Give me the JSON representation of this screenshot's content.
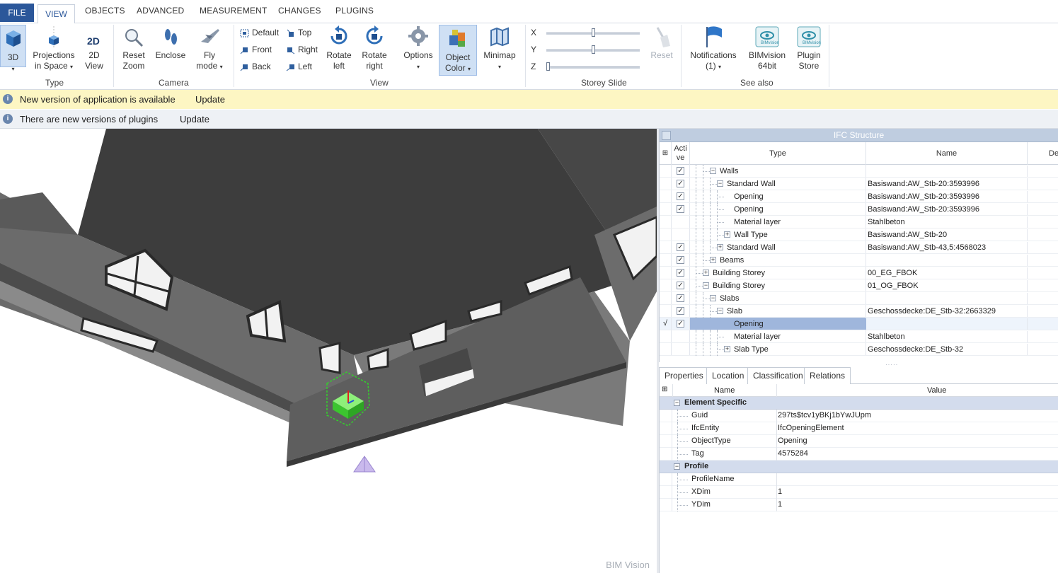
{
  "menu": {
    "file": "FILE",
    "tabs": [
      "VIEW",
      "OBJECTS",
      "ADVANCED",
      "MEASUREMENT",
      "CHANGES",
      "PLUGINS"
    ]
  },
  "ribbon": {
    "type_group": {
      "label": "Type",
      "btn_3d": "3D",
      "projections": [
        "Projections",
        "in Space"
      ],
      "view2d": [
        "2D",
        "View"
      ]
    },
    "camera_group": {
      "label": "Camera",
      "reset_zoom": [
        "Reset",
        "Zoom"
      ],
      "enclose": "Enclose",
      "fly_mode": [
        "Fly",
        "mode"
      ]
    },
    "view_group": {
      "label": "View",
      "default": "Default",
      "front": "Front",
      "back": "Back",
      "top": "Top",
      "right": "Right",
      "left": "Left",
      "rotate_left": [
        "Rotate",
        "left"
      ],
      "rotate_right": [
        "Rotate",
        "right"
      ],
      "options": "Options",
      "object_color": [
        "Object",
        "Color"
      ],
      "minimap": "Minimap"
    },
    "storey_group": {
      "label": "Storey Slide",
      "x": "X",
      "y": "Y",
      "z": "Z",
      "reset": "Reset",
      "x_pos": 0.5,
      "y_pos": 0.5,
      "z_pos": 0.0
    },
    "see_also_group": {
      "label": "See also",
      "notifications": [
        "Notifications",
        "(1)"
      ],
      "bimvision": [
        "BIMvision",
        "64bit"
      ],
      "plugin_store": [
        "Plugin",
        "Store"
      ],
      "logo_text": "BIMvision"
    }
  },
  "info_bars": [
    {
      "message": "New version of application is available",
      "action": "Update"
    },
    {
      "message": "There are new versions of plugins",
      "action": "Update"
    }
  ],
  "viewport": {
    "watermark": "BIM Vision"
  },
  "ifc_structure": {
    "title": "IFC Structure",
    "columns": {
      "active": "Acti ve",
      "type": "Type",
      "name": "Name",
      "desc": "De"
    },
    "rows": [
      {
        "type": "Walls",
        "name": "",
        "level": 2,
        "expander": "−",
        "checked": true
      },
      {
        "type": "Standard Wall",
        "name": "Basiswand:AW_Stb-20:3593996",
        "level": 3,
        "expander": "−",
        "checked": true
      },
      {
        "type": "Opening",
        "name": "Basiswand:AW_Stb-20:3593996",
        "level": 4,
        "expander": "",
        "checked": true
      },
      {
        "type": "Opening",
        "name": "Basiswand:AW_Stb-20:3593996",
        "level": 4,
        "expander": "",
        "checked": true
      },
      {
        "type": "Material layer",
        "name": "Stahlbeton",
        "level": 4,
        "expander": "",
        "checked": false
      },
      {
        "type": "Wall Type",
        "name": "Basiswand:AW_Stb-20",
        "level": 4,
        "expander": "+",
        "checked": false
      },
      {
        "type": "Standard Wall",
        "name": "Basiswand:AW_Stb-43,5:4568023",
        "level": 3,
        "expander": "+",
        "checked": true
      },
      {
        "type": "Beams",
        "name": "",
        "level": 2,
        "expander": "+",
        "checked": true
      },
      {
        "type": "Building Storey",
        "name": "00_EG_FBOK",
        "level": 1,
        "expander": "+",
        "checked": true
      },
      {
        "type": "Building Storey",
        "name": "01_OG_FBOK",
        "level": 1,
        "expander": "−",
        "checked": true
      },
      {
        "type": "Slabs",
        "name": "",
        "level": 2,
        "expander": "−",
        "checked": true
      },
      {
        "type": "Slab",
        "name": "Geschossdecke:DE_Stb-32:2663329",
        "level": 3,
        "expander": "−",
        "checked": true
      },
      {
        "type": "Opening",
        "name": "",
        "level": 4,
        "expander": "",
        "checked": true,
        "selected": true,
        "indicator": "√"
      },
      {
        "type": "Material layer",
        "name": "Stahlbeton",
        "level": 4,
        "expander": "",
        "checked": false
      },
      {
        "type": "Slab Type",
        "name": "Geschossdecke:DE_Stb-32",
        "level": 4,
        "expander": "+",
        "checked": false
      }
    ]
  },
  "property_tabs": [
    "Properties",
    "Location",
    "Classification",
    "Relations"
  ],
  "properties": {
    "columns": {
      "name": "Name",
      "value": "Value"
    },
    "categories": [
      {
        "title": "Element Specific",
        "items": [
          {
            "name": "Guid",
            "value": "297ts$tcv1yBKj1bYwJUpm"
          },
          {
            "name": "IfcEntity",
            "value": "IfcOpeningElement"
          },
          {
            "name": "ObjectType",
            "value": "Opening"
          },
          {
            "name": "Tag",
            "value": "4575284"
          }
        ]
      },
      {
        "title": "Profile",
        "items": [
          {
            "name": "ProfileName",
            "value": ""
          },
          {
            "name": "XDim",
            "value": "1"
          },
          {
            "name": "YDim",
            "value": "1"
          }
        ]
      }
    ]
  }
}
